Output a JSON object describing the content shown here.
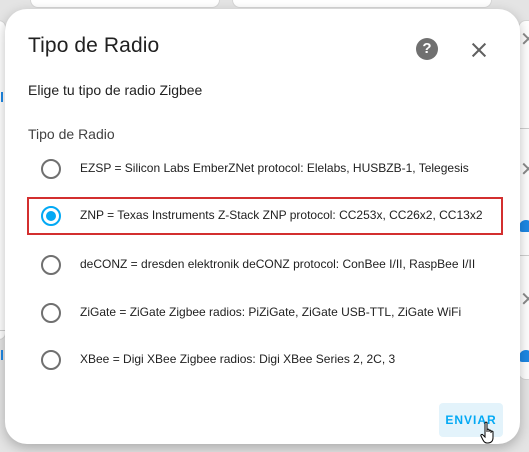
{
  "dialog": {
    "title": "Tipo de Radio",
    "subtitle": "Elige tu tipo de radio Zigbee",
    "group_label": "Tipo de Radio",
    "help_icon": "help-circle-icon",
    "help_glyph": "?",
    "close_icon": "close-icon",
    "options": [
      {
        "label": "EZSP = Silicon Labs EmberZNet protocol: Elelabs, HUSBZB-1, Telegesis",
        "selected": false
      },
      {
        "label": "ZNP = Texas Instruments Z-Stack ZNP protocol: CC253x, CC26x2, CC13x2",
        "selected": true
      },
      {
        "label": "deCONZ = dresden elektronik deCONZ protocol: ConBee I/II, RaspBee I/II",
        "selected": false
      },
      {
        "label": "ZiGate = ZiGate Zigbee radios: PiZiGate, ZiGate USB-TTL, ZiGate WiFi",
        "selected": false
      },
      {
        "label": "XBee = Digi XBee Zigbee radios: Digi XBee Series 2, 2C, 3",
        "selected": false
      }
    ],
    "submit_label": "ENVIAR"
  },
  "colors": {
    "accent": "#03a9f4",
    "highlight_border": "#d32f2f",
    "overlay": "#e4e4e4"
  }
}
